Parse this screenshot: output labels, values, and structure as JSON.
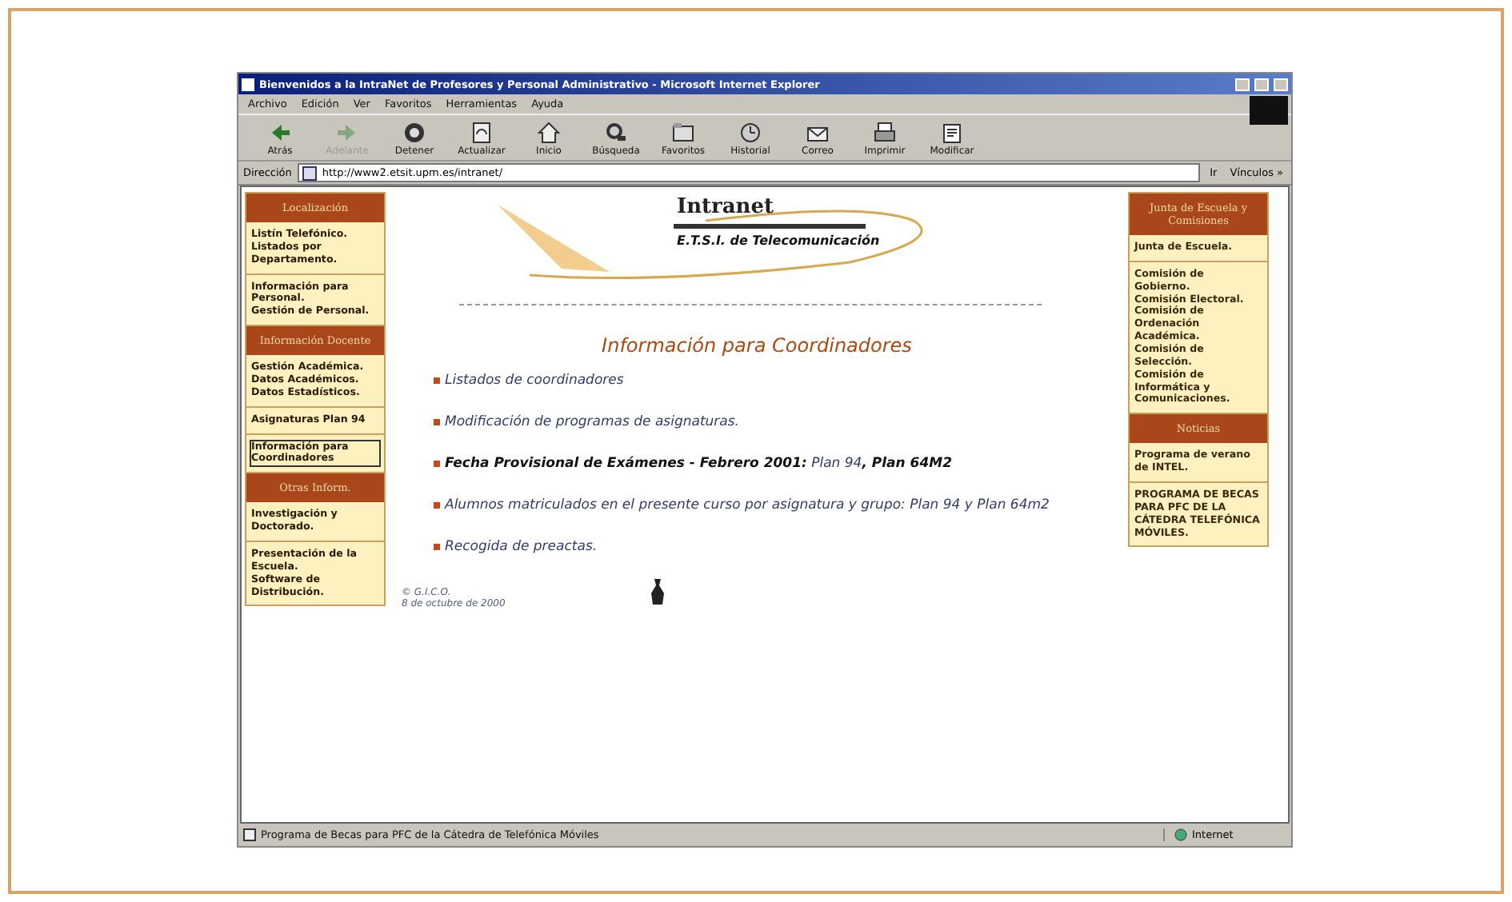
{
  "window": {
    "title": "Bienvenidos a la IntraNet de Profesores y Personal Administrativo - Microsoft Internet Explorer"
  },
  "menu": [
    "Archivo",
    "Edición",
    "Ver",
    "Favoritos",
    "Herramientas",
    "Ayuda"
  ],
  "toolbar": [
    {
      "label": "Atrás",
      "kind": "back",
      "disabled": false
    },
    {
      "label": "Adelante",
      "kind": "forward",
      "disabled": true
    },
    {
      "label": "Detener",
      "kind": "stop",
      "disabled": false
    },
    {
      "label": "Actualizar",
      "kind": "refresh",
      "disabled": false
    },
    {
      "label": "Inicio",
      "kind": "home",
      "disabled": false
    },
    {
      "label": "Búsqueda",
      "kind": "search",
      "disabled": false
    },
    {
      "label": "Favoritos",
      "kind": "favorites",
      "disabled": false
    },
    {
      "label": "Historial",
      "kind": "history",
      "disabled": false
    },
    {
      "label": "Correo",
      "kind": "mail",
      "disabled": false
    },
    {
      "label": "Imprimir",
      "kind": "print",
      "disabled": false
    },
    {
      "label": "Modificar",
      "kind": "edit",
      "disabled": false
    }
  ],
  "address": {
    "label": "Dirección",
    "url": "http://www2.etsit.upm.es/intranet/",
    "go": "Ir",
    "links": "Vínculos »"
  },
  "left_sidebar": [
    {
      "title": "Localización",
      "groups": [
        [
          {
            "label": "Listín Telefónico.",
            "selected": false
          },
          {
            "label": "Listados por Departamento.",
            "selected": false
          }
        ],
        [
          {
            "label": "Información para Personal.",
            "selected": false
          },
          {
            "label": "Gestión de Personal.",
            "selected": false
          }
        ]
      ]
    },
    {
      "title": "Información Docente",
      "groups": [
        [
          {
            "label": "Gestión Académica.",
            "selected": false
          },
          {
            "label": "Datos Académicos.",
            "selected": false
          },
          {
            "label": "Datos Estadísticos.",
            "selected": false
          }
        ],
        [
          {
            "label": "Asignaturas Plan 94",
            "selected": false
          }
        ],
        [
          {
            "label": "Información para Coordinadores",
            "selected": true
          }
        ]
      ]
    },
    {
      "title": "Otras Inform.",
      "groups": [
        [
          {
            "label": "Investigación y Doctorado.",
            "selected": false
          }
        ],
        [
          {
            "label": "Presentación de la Escuela.",
            "selected": false
          },
          {
            "label": "Software de Distribución.",
            "selected": false
          }
        ]
      ]
    }
  ],
  "logo": {
    "title": "Intranet",
    "subtitle": "E.T.S.I. de Telecomunicación"
  },
  "heading": "Información para Coordinadores",
  "items": [
    {
      "text": "Listados de coordinadores"
    },
    {
      "text": "Modificación de programas de asignaturas."
    },
    {
      "text": "**Fecha Provisional de Exámenes - Febrero 2001:** Plan 94**, Plan 64M2**"
    },
    {
      "text": "Alumnos matriculados en el presente curso por asignatura y grupo: Plan 94 y Plan 64m2"
    },
    {
      "text": "Recogida de preactas."
    }
  ],
  "footer": {
    "copyright": "© G.I.C.O.",
    "date": "8 de octubre de 2000"
  },
  "right_sidebar": [
    {
      "title": "Junta de Escuela y Comisiones",
      "groups": [
        [
          "Junta de Escuela."
        ],
        [
          "Comisión de Gobierno.",
          "Comisión Electoral.",
          "Comisión de Ordenación Académica.",
          "Comisión de Selección.",
          "Comisión de Informática y Comunicaciones."
        ]
      ]
    },
    {
      "title": "Noticias",
      "groups": [
        [
          "Programa de verano de INTEL."
        ],
        [
          "PROGRAMA DE BECAS PARA PFC DE LA CÁTEDRA TELEFÓNICA MÓVILES."
        ]
      ]
    }
  ],
  "status_bar": {
    "text": "Programa de Becas para PFC de la Cátedra de Telefónica Móviles",
    "zone": "Internet"
  }
}
